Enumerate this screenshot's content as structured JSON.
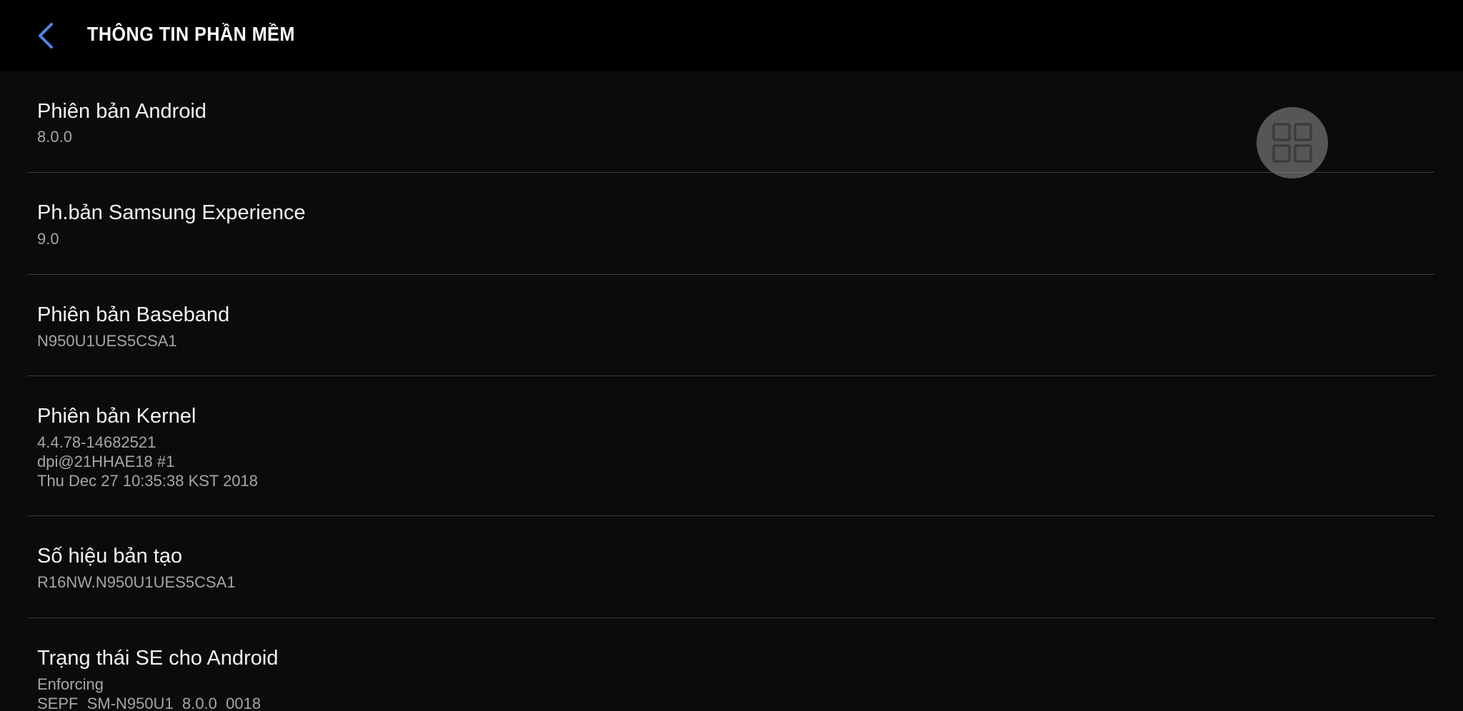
{
  "header": {
    "title": "THÔNG TIN PHẦN MỀM"
  },
  "colors": {
    "background": "#0b0b0b",
    "header_background": "#000000",
    "accent_back": "#4f86e6",
    "title_text": "#f2f2f2",
    "subtitle_text": "#a6a6a6",
    "divider": "#3a3a3a"
  },
  "items": [
    {
      "title": "Phiên bản Android",
      "lines": [
        "8.0.0"
      ]
    },
    {
      "title": "Ph.bản Samsung Experience",
      "lines": [
        "9.0"
      ]
    },
    {
      "title": "Phiên bản Baseband",
      "lines": [
        "N950U1UES5CSA1"
      ]
    },
    {
      "title": "Phiên bản Kernel",
      "lines": [
        "4.4.78-14682521",
        "dpi@21HHAE18 #1",
        "Thu Dec 27 10:35:38 KST 2018"
      ]
    },
    {
      "title": "Số hiệu bản tạo",
      "lines": [
        "R16NW.N950U1UES5CSA1"
      ]
    },
    {
      "title": "Trạng thái SE cho Android",
      "lines": [
        "Enforcing",
        "SEPF_SM-N950U1_8.0.0_0018"
      ]
    }
  ],
  "icons": {
    "back": "back-arrow-icon",
    "floating": "grid-icon"
  }
}
